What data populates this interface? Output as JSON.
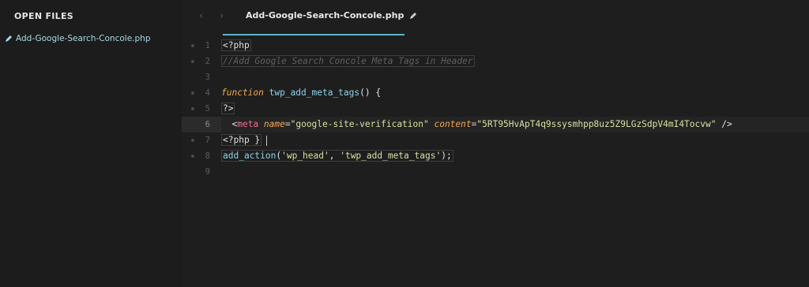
{
  "sidebar": {
    "title": "OPEN FILES",
    "files": [
      "Add-Google-Search-Concole.php"
    ]
  },
  "tabbar": {
    "back_glyph": "‹",
    "forward_glyph": "›",
    "active_tab": "Add-Google-Search-Concole.php"
  },
  "editor": {
    "lines": [
      {
        "num": "1",
        "t1": "<?php"
      },
      {
        "num": "2",
        "t1": "//Add Google Search Concole Meta Tags in Header"
      },
      {
        "num": "3"
      },
      {
        "num": "4",
        "t1": "function",
        "t2": " twp_add_meta_tags",
        "t3": "() {"
      },
      {
        "num": "5",
        "t1": "?>"
      },
      {
        "num": "6",
        "t1": "  <",
        "t2": "meta",
        "t3": " name",
        "t4": "=",
        "t5": "\"google-site-verification\"",
        "t6": " content",
        "t7": "=",
        "t8": "\"5RT95HvApT4q9ssysmhpp8uz5Z9LGzSdpV4mI4Tocvw\"",
        "t9": " />"
      },
      {
        "num": "7",
        "t1": "<?php }"
      },
      {
        "num": "8",
        "t1": "add_action",
        "t2": "(",
        "t3": "'wp_head'",
        "t4": ", ",
        "t5": "'twp_add_meta_tags'",
        "t6": ");"
      },
      {
        "num": "9"
      }
    ]
  },
  "colors": {
    "background": "#1e1e1e",
    "accent": "#5fb3c9",
    "keyword": "#f0a850",
    "tag": "#f06e8b",
    "string": "#d8e0a0"
  }
}
